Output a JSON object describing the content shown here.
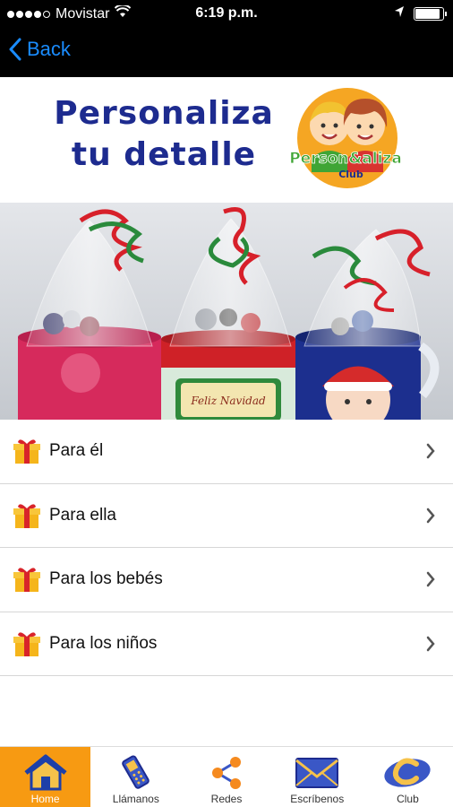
{
  "status_bar": {
    "carrier": "Movistar",
    "time": "6:19 p.m.",
    "battery_level": 0.9
  },
  "nav": {
    "back_label": "Back"
  },
  "banner": {
    "title": "Personaliza tu detalle",
    "logo_text": "Person&aliza",
    "logo_subtext": "Club"
  },
  "hero": {
    "mug_text": "Feliz Navidad"
  },
  "menu": {
    "items": [
      {
        "label": "Para él"
      },
      {
        "label": "Para ella"
      },
      {
        "label": "Para los bebés"
      },
      {
        "label": "Para los niños"
      }
    ]
  },
  "tabs": [
    {
      "label": "Home",
      "icon": "home-icon",
      "active": true
    },
    {
      "label": "Llámanos",
      "icon": "phone-icon",
      "active": false
    },
    {
      "label": "Redes",
      "icon": "share-icon",
      "active": false
    },
    {
      "label": "Escríbenos",
      "icon": "mail-icon",
      "active": false
    },
    {
      "label": "Club",
      "icon": "club-icon",
      "active": false
    }
  ],
  "colors": {
    "accent": "#f79a12",
    "link": "#1a8cff",
    "title": "#1d2b8f"
  }
}
